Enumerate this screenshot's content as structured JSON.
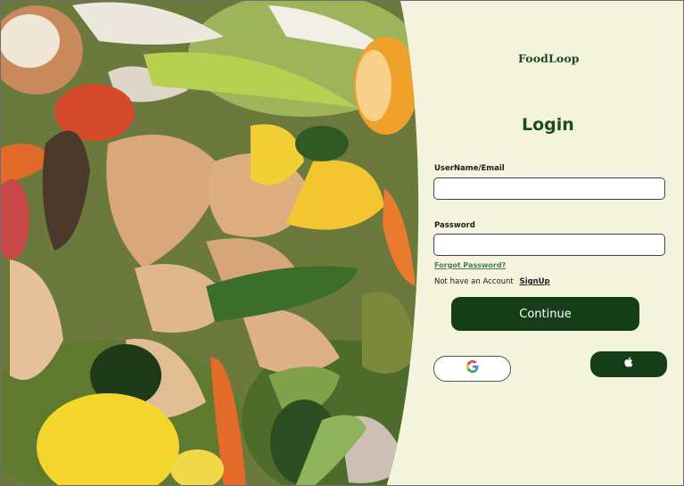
{
  "brand": {
    "name": "FoodLoop"
  },
  "login": {
    "title": "Login",
    "username_label": "UserName/Email",
    "username_value": "",
    "password_label": "Password",
    "password_value": "",
    "forgot_password": "Forgot Password?",
    "no_account_text": "Not have an Account",
    "signup_link": "SignUp",
    "continue_button": "Continue"
  },
  "social": {
    "google_icon": "google-g-icon",
    "apple_icon": "apple-icon"
  },
  "colors": {
    "panel_background": "#f4f3dd",
    "brand_green": "#1e4a23",
    "button_green": "#143d18",
    "link_green": "#4f7a52"
  }
}
